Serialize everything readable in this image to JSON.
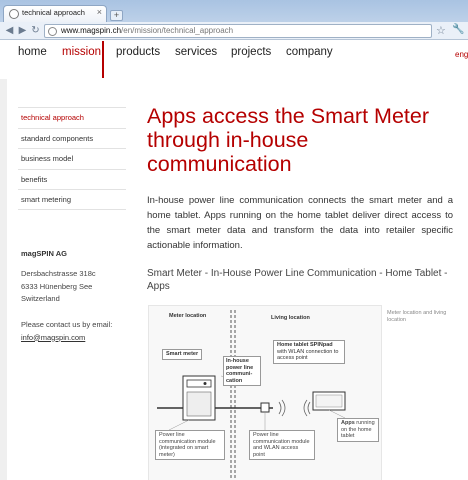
{
  "browser": {
    "tab_title": "technical approach",
    "tab_close": "×",
    "new_tab": "+",
    "url_host": "www.magspin.ch",
    "url_path": "/en/mission/technical_approach",
    "back": "◀",
    "forward": "▶",
    "reload": "↻",
    "star": "☆",
    "wrench": "🔧"
  },
  "nav": {
    "items": [
      "home",
      "mission",
      "products",
      "services",
      "projects",
      "company"
    ],
    "active": "mission",
    "language": "engl"
  },
  "sidebar": {
    "items": [
      "technical approach",
      "standard components",
      "business model",
      "benefits",
      "smart metering"
    ],
    "active": "technical approach"
  },
  "address": {
    "company": "magSPIN AG",
    "street": "Dersbachstrasse 318c",
    "city": "6333 Hünenberg See",
    "country": "Switzerland",
    "contact_text": "Please contact us by email:",
    "email": "info@magspin.com"
  },
  "main": {
    "headline": "Apps access the Smart Meter through in-house communication",
    "intro": "In-house power line communication connects the smart meter and a home tablet. Apps running on the home tablet deliver direct access to the smart meter data and transform the data into retailer specific actionable information.",
    "subtitle": "Smart Meter - In-House Power Line Communication - Home Tablet - Apps"
  },
  "diagram": {
    "meter_location": "Meter location",
    "living_location": "Living location",
    "smart_meter": "Smart meter",
    "inhouse": "In-house power line communi- cation",
    "tablet_title": "Home tablet SPINpad",
    "tablet_desc": "with WLAN connection to access point",
    "apps_label": "Apps",
    "apps_desc": "running on the home tablet",
    "plc_meter": "Power line communication module (integrated on smart meter)",
    "plc_wlan": "Power line communication module and WLAN access point",
    "caption": "Meter location and living location"
  },
  "colors": {
    "accent": "#b50000",
    "chrome": "#a9c3e2"
  }
}
